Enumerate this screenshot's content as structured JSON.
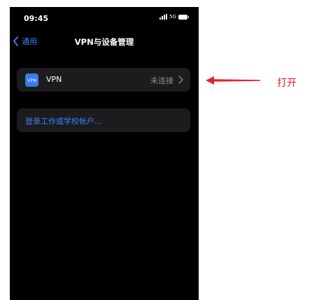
{
  "status_bar": {
    "time": "09:45",
    "network": "5G"
  },
  "nav": {
    "back_label": "通用",
    "title": "VPN与设备管理"
  },
  "vpn_row": {
    "icon_text": "VPN",
    "label": "VPN",
    "status": "未连接"
  },
  "login_row": {
    "label": "登录工作或学校帐户..."
  },
  "annotation": {
    "text": "打开",
    "color": "#e0242a"
  },
  "colors": {
    "accent": "#3a82f7",
    "cell_bg": "#1c1c1e",
    "screen_bg": "#000000",
    "vpn_icon_bg": "#3b7bef"
  },
  "icons": [
    "chevron-left-icon",
    "signal-icon",
    "battery-icon",
    "vpn-icon",
    "chevron-right-icon",
    "red-arrow-icon"
  ]
}
